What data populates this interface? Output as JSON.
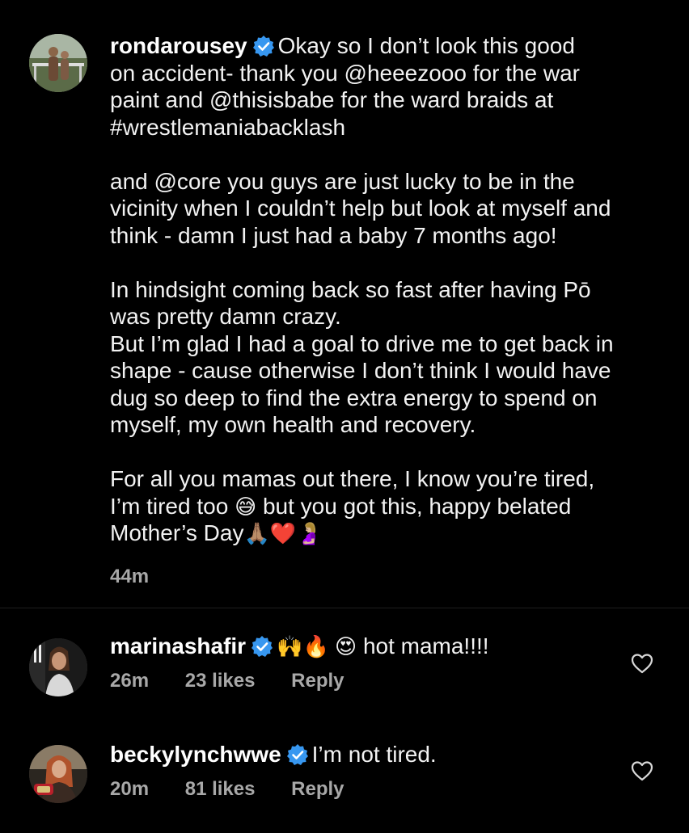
{
  "post": {
    "username": "rondarousey",
    "caption_lines": [
      "Okay so I don’t look this good",
      "on accident- thank you @heeezooo for the war",
      "paint and @thisisbabe for the ward braids at",
      "#wrestlemaniabacklash",
      "",
      "and @core you guys are just lucky to be in the",
      "vicinity when I couldn’t help but look at myself and",
      "think - damn I just had a baby 7 months ago!",
      "",
      "In hindsight coming back so fast after having Pō",
      "was pretty damn crazy.",
      "But I’m glad I had a goal to drive me to get back in",
      "shape - cause otherwise I don’t think I would have",
      "dug so deep to find the extra energy to spend on",
      "myself, my own health and recovery.",
      "",
      "For all you mamas out there, I know you’re tired,",
      "I’m tired too",
      "but you got this, happy belated",
      "Mother’s Day"
    ],
    "emoji_sweat": "😅",
    "emoji_end": "🙏🏽❤️🤰🏼",
    "time": "44m"
  },
  "comments": [
    {
      "username": "marinashafir",
      "emoji": "🙌🔥 😍",
      "text": "hot mama!!!!",
      "time": "26m",
      "likes": "23 likes",
      "reply": "Reply"
    },
    {
      "username": "beckylynchwwe",
      "emoji": "",
      "text": "I’m not tired.",
      "time": "20m",
      "likes": "81 likes",
      "reply": "Reply"
    }
  ],
  "colors": {
    "verified": "#3797f0",
    "secondary_text": "#a8a8a8",
    "background": "#000000"
  },
  "icons": {
    "verified": "verified-badge-icon",
    "like": "heart-outline-icon"
  }
}
